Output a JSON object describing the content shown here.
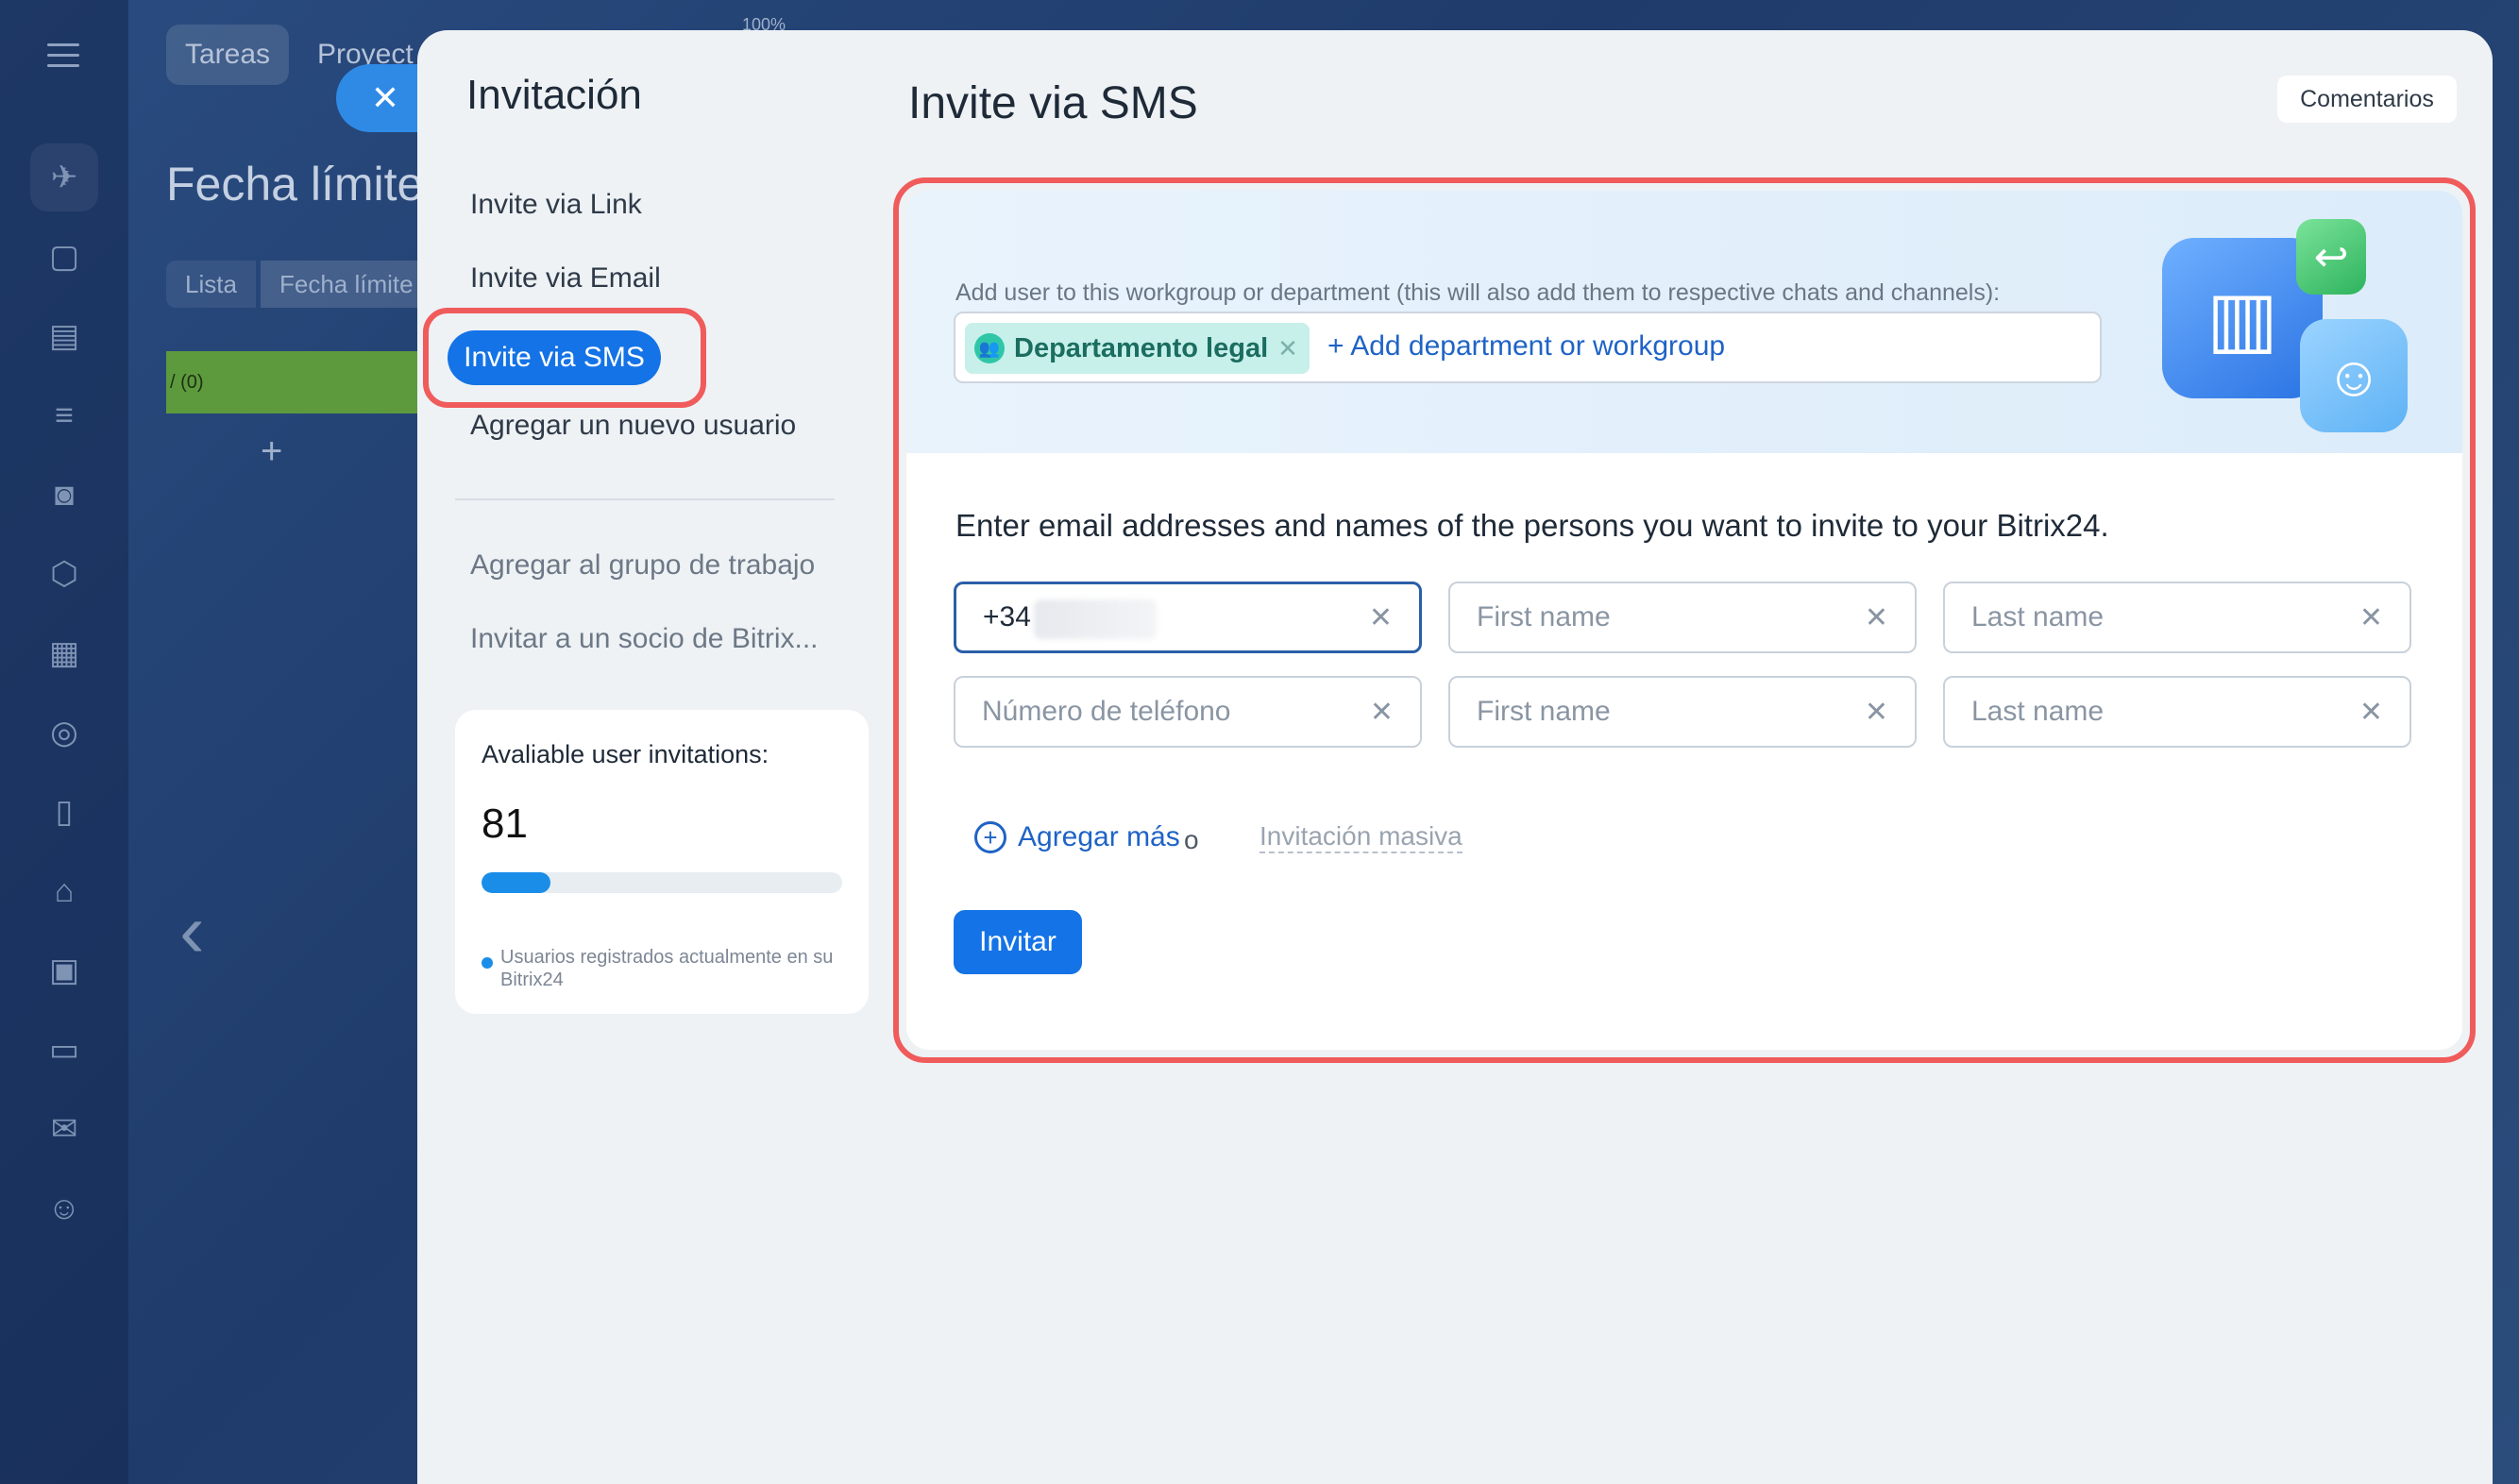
{
  "background": {
    "tabs": [
      "Tareas",
      "Proyect"
    ],
    "zoom": "100%",
    "title": "Fecha límite",
    "filters": [
      "Lista",
      "Fecha límite"
    ],
    "column_label": "/ (0)",
    "add_symbol": "+"
  },
  "nav": {
    "title": "Invitación",
    "items": [
      {
        "label": "Invite via Link"
      },
      {
        "label": "Invite via Email"
      },
      {
        "label": "Invite via SMS",
        "active": true
      },
      {
        "label": "Agregar un nuevo usuario"
      },
      {
        "label": "Agregar al grupo de trabajo"
      },
      {
        "label": "Invitar a un socio de Bitrix..."
      }
    ]
  },
  "quota": {
    "label": "Avaliable user invitations:",
    "value": "81",
    "fill_fraction": 0.19,
    "note": "Usuarios registrados actualmente en su Bitrix24"
  },
  "main": {
    "title": "Invite via SMS",
    "comments_label": "Comentarios",
    "department": {
      "label": "Add user to this workgroup or department (this will also add them to respective chats and channels):",
      "tag": "Departamento legal",
      "add_link": "+ Add department or workgroup"
    },
    "instruction": "Enter email addresses and names of the persons you want to invite to your Bitrix24.",
    "rows": [
      {
        "phone_value": "+34",
        "phone_placeholder": "Número de teléfono",
        "first_placeholder": "First name",
        "last_placeholder": "Last name"
      },
      {
        "phone_value": "",
        "phone_placeholder": "Número de teléfono",
        "first_placeholder": "First name",
        "last_placeholder": "Last name"
      }
    ],
    "add_more": "Agregar más",
    "or": "o",
    "mass_invite": "Invitación masiva",
    "invite_button": "Invitar"
  },
  "colors": {
    "accent": "#1473e6",
    "highlight": "#f05b5b",
    "tag_bg": "#c7f0ea"
  }
}
